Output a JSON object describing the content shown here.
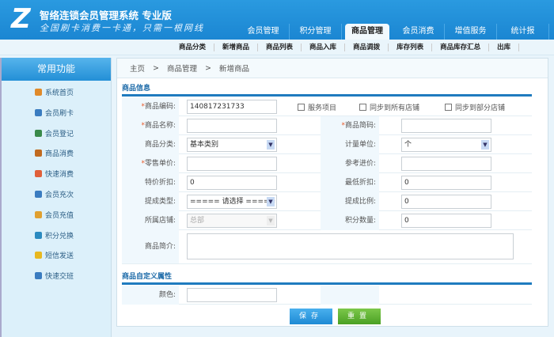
{
  "header": {
    "app_title": "智络连锁会员管理系统 专业版",
    "slogan": "全国刷卡消费一卡通，只需一根网线",
    "tabs": [
      "会员管理",
      "积分管理",
      "商品管理",
      "会员消费",
      "增值服务",
      "统计报"
    ],
    "active_tab": "商品管理"
  },
  "subnav": [
    "商品分类",
    "新增商品",
    "商品列表",
    "商品入库",
    "商品调拨",
    "库存列表",
    "商品库存汇总",
    "出库"
  ],
  "sidebar": {
    "title": "常用功能",
    "items": [
      {
        "label": "系统首页",
        "icon": "home-icon",
        "color": "#e08a2a"
      },
      {
        "label": "会员刷卡",
        "icon": "user-card-icon",
        "color": "#3a7cc0"
      },
      {
        "label": "会员登记",
        "icon": "users-icon",
        "color": "#3a8a4a"
      },
      {
        "label": "商品消费",
        "icon": "cart-icon",
        "color": "#c06a20"
      },
      {
        "label": "快速消费",
        "icon": "edit-icon",
        "color": "#e0603a"
      },
      {
        "label": "会员充次",
        "icon": "recharge-icon",
        "color": "#3a7cc0"
      },
      {
        "label": "会员充值",
        "icon": "wallet-icon",
        "color": "#e0a030"
      },
      {
        "label": "积分兑换",
        "icon": "gift-icon",
        "color": "#2a8ac0"
      },
      {
        "label": "短信发送",
        "icon": "mail-icon",
        "color": "#e8b820"
      },
      {
        "label": "快速交班",
        "icon": "shift-icon",
        "color": "#3a7cc0"
      }
    ]
  },
  "breadcrumb": [
    "主页",
    "商品管理",
    "新增商品"
  ],
  "form": {
    "section1": "商品信息",
    "code_label": "商品编码:",
    "code_value": "140817231733",
    "service_item": "服务项目",
    "sync_all": "同步到所有店铺",
    "sync_some": "同步到部分店铺",
    "name_label": "商品名称:",
    "short_code_label": "商品简码:",
    "category_label": "商品分类:",
    "category_value": "基本类别",
    "unit_label": "计量单位:",
    "unit_value": "个",
    "price_label": "零售单价:",
    "ref_price_label": "参考进价:",
    "special_discount_label": "特价折扣:",
    "special_discount_value": "0",
    "min_discount_label": "最低折扣:",
    "min_discount_value": "0",
    "commission_type_label": "提成类型:",
    "commission_type_value": "===== 请选择 =====",
    "commission_ratio_label": "提成比例:",
    "commission_ratio_value": "0",
    "store_label": "所属店铺:",
    "store_value": "总部",
    "points_label": "积分数量:",
    "points_value": "0",
    "desc_label": "商品简介:",
    "section2": "商品自定义属性",
    "color_label": "颜色:",
    "save": "保存",
    "reset": "重置"
  }
}
